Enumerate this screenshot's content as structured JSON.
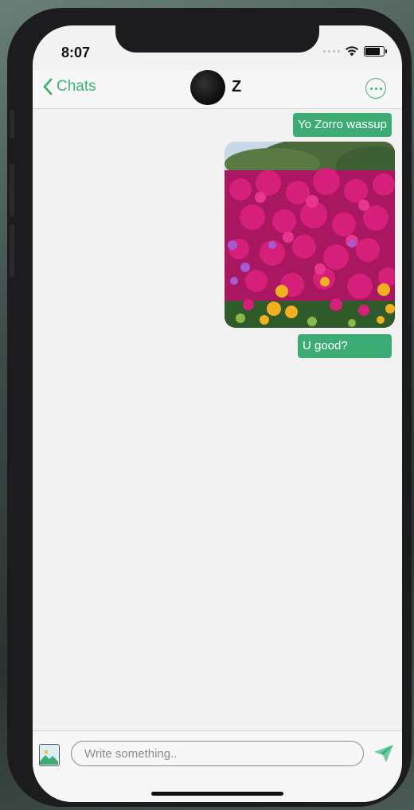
{
  "status": {
    "time": "8:07"
  },
  "header": {
    "back_label": "Chats",
    "contact_name": "Z"
  },
  "messages": [
    {
      "type": "text",
      "text": "Yo Zorro wassup"
    },
    {
      "type": "image",
      "description": "photo"
    },
    {
      "type": "text",
      "text": "U good?"
    }
  ],
  "composer": {
    "placeholder": "Write something.."
  },
  "colors": {
    "accent": "#3cb371",
    "bubble": "#3dab74",
    "background": "#f2f2f2"
  }
}
